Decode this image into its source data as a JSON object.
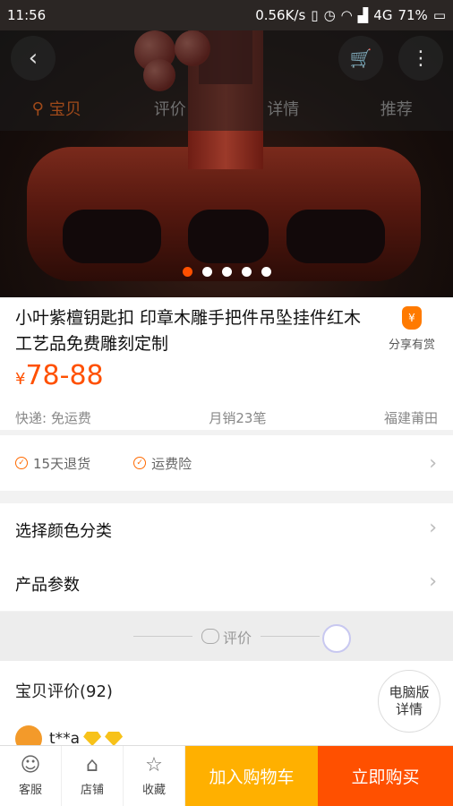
{
  "status_bar": {
    "time": "11:56",
    "net_speed": "0.56K/s",
    "network": "4G",
    "battery": "71%"
  },
  "nav": {
    "tabs": [
      {
        "label": "宝贝",
        "active": true
      },
      {
        "label": "评价",
        "active": false
      },
      {
        "label": "详情",
        "active": false
      },
      {
        "label": "推荐",
        "active": false
      }
    ]
  },
  "carousel": {
    "count": 5,
    "active_index": 0
  },
  "product": {
    "title": "小叶紫檀钥匙扣 印章木雕手把件吊坠挂件红木工艺品免费雕刻定制",
    "share_label": "分享有赏",
    "share_badge": "¥",
    "price_symbol": "¥",
    "price": "78-88",
    "shipping": "快递: 免运费",
    "monthly_sales": "月销23笔",
    "location": "福建莆田"
  },
  "services": [
    {
      "label": "15天退货"
    },
    {
      "label": "运费险"
    }
  ],
  "options": {
    "color_label": "选择颜色分类",
    "params_label": "产品参数"
  },
  "review_divider": {
    "label": "评价"
  },
  "reviews": {
    "header": "宝贝评价(92)",
    "pc_line1": "电脑版",
    "pc_line2": "详情",
    "first_user": "t**a"
  },
  "bottom_bar": {
    "service": "客服",
    "shop": "店铺",
    "favorite": "收藏",
    "add_to_cart": "加入购物车",
    "buy_now": "立即购买"
  },
  "colors": {
    "accent": "#ff5000",
    "cart": "#ffb000"
  }
}
